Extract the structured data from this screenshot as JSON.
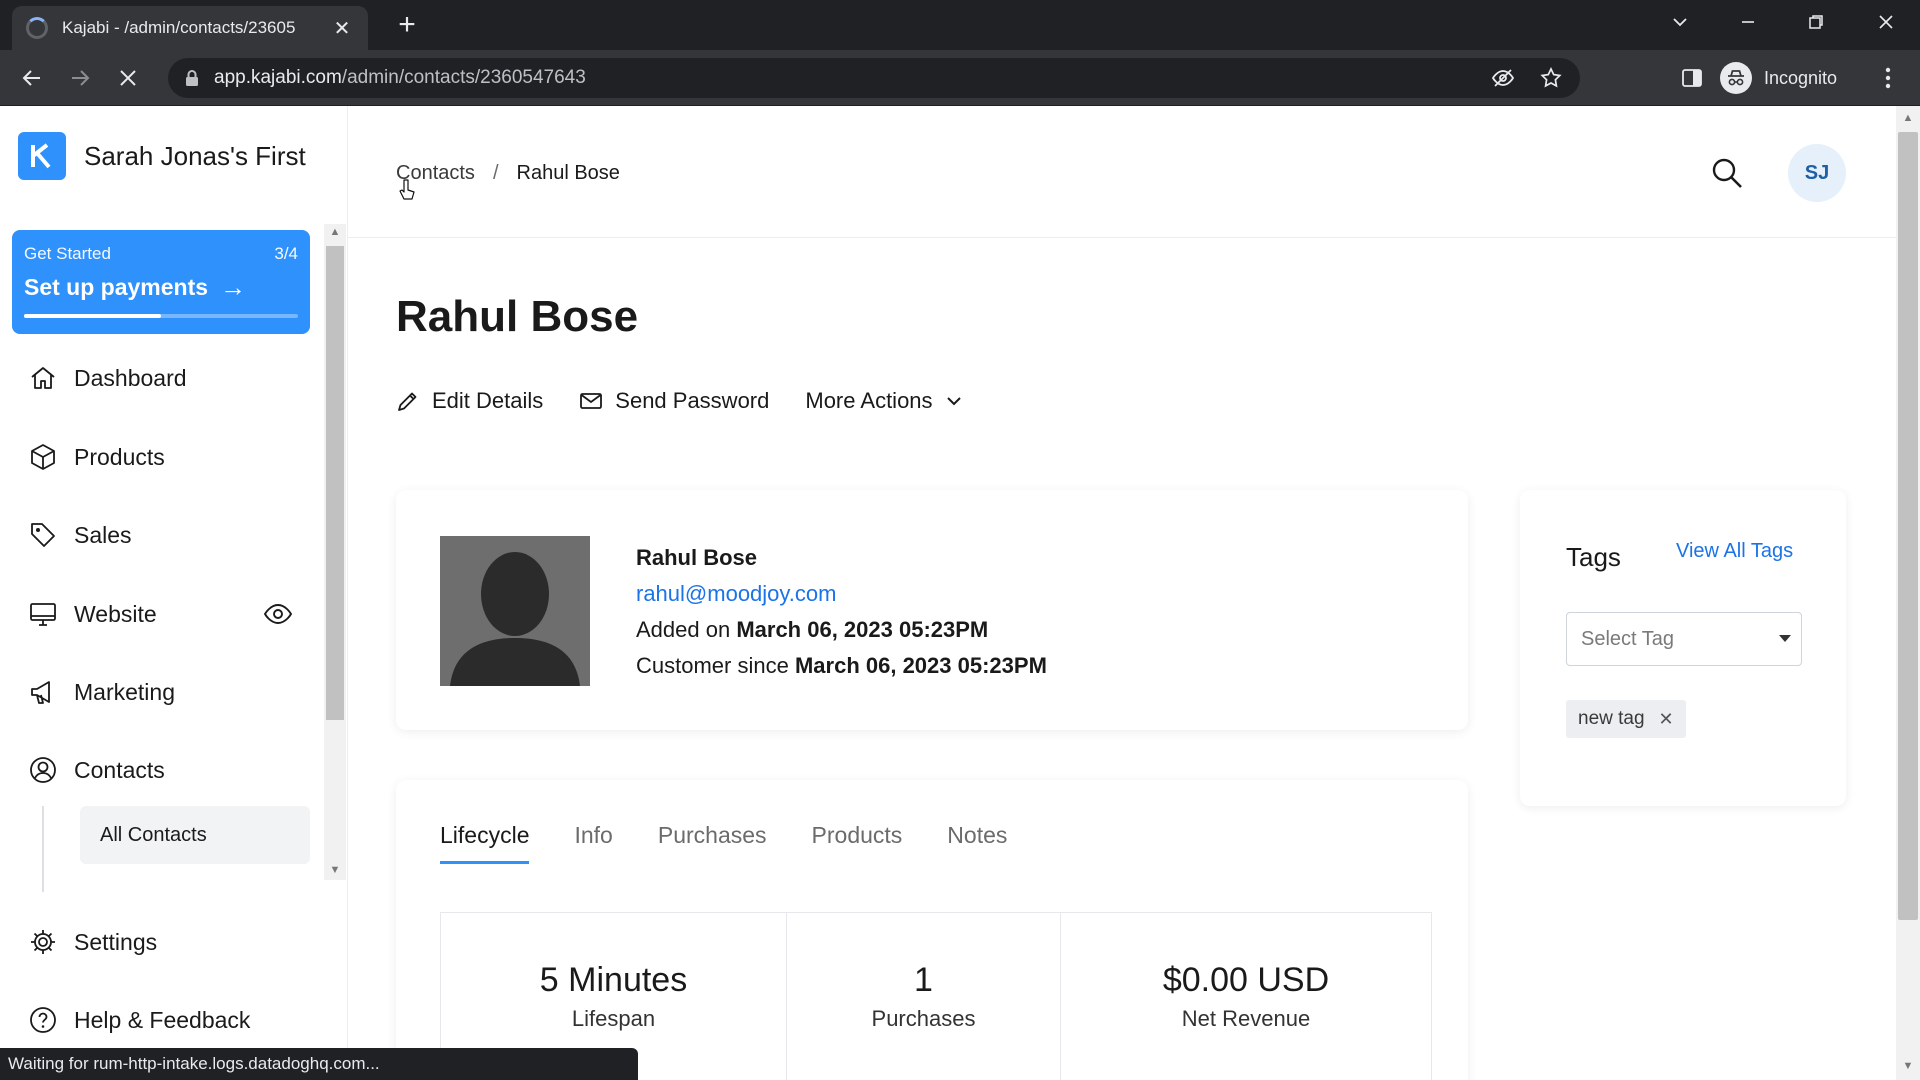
{
  "browser": {
    "tab_title": "Kajabi - /admin/contacts/23605",
    "tab_close": "✕",
    "new_tab": "+",
    "url_host": "app.kajabi.com",
    "url_path": "/admin/contacts/2360547643",
    "profile_label": "Incognito",
    "status_text": "Waiting for rum-http-intake.logs.datadoghq.com..."
  },
  "sidebar": {
    "brand_name": "Sarah Jonas's First",
    "get_started": {
      "label": "Get Started",
      "progress_text": "3/4",
      "title": "Set up payments",
      "arrow": "→",
      "progress_fraction": 0.5
    },
    "items": [
      {
        "label": "Dashboard",
        "icon": "home-icon"
      },
      {
        "label": "Products",
        "icon": "box-icon"
      },
      {
        "label": "Sales",
        "icon": "tag-icon"
      },
      {
        "label": "Website",
        "icon": "monitor-icon"
      },
      {
        "label": "Marketing",
        "icon": "megaphone-icon"
      },
      {
        "label": "Contacts",
        "icon": "user-circle-icon"
      },
      {
        "label": "Settings",
        "icon": "gear-icon"
      },
      {
        "label": "Help & Feedback",
        "icon": "help-icon"
      }
    ],
    "sub_items": [
      {
        "label": "All Contacts"
      }
    ]
  },
  "header": {
    "breadcrumb_parent": "Contacts",
    "breadcrumb_sep": "/",
    "breadcrumb_current": "Rahul Bose",
    "avatar_initials": "SJ"
  },
  "contact": {
    "page_title": "Rahul Bose",
    "actions": {
      "edit": "Edit Details",
      "send_password": "Send Password",
      "more": "More Actions"
    },
    "name": "Rahul Bose",
    "email": "rahul@moodjoy.com",
    "added_label": "Added on",
    "added_value": "March 06, 2023 05:23PM",
    "customer_label": "Customer since",
    "customer_value": "March 06, 2023 05:23PM"
  },
  "tags": {
    "title": "Tags",
    "view_all": "View All Tags",
    "select_placeholder": "Select Tag",
    "chips": [
      {
        "label": "new tag",
        "remove": "✕"
      }
    ]
  },
  "tabs": [
    {
      "label": "Lifecycle",
      "active": true
    },
    {
      "label": "Info",
      "active": false
    },
    {
      "label": "Purchases",
      "active": false
    },
    {
      "label": "Products",
      "active": false
    },
    {
      "label": "Notes",
      "active": false
    }
  ],
  "stats": [
    {
      "value": "5 Minutes",
      "label": "Lifespan"
    },
    {
      "value": "1",
      "label": "Purchases"
    },
    {
      "value": "$0.00 USD",
      "label": "Net Revenue"
    }
  ],
  "colors": {
    "accent": "#2e91fc",
    "link": "#1a73e8"
  }
}
